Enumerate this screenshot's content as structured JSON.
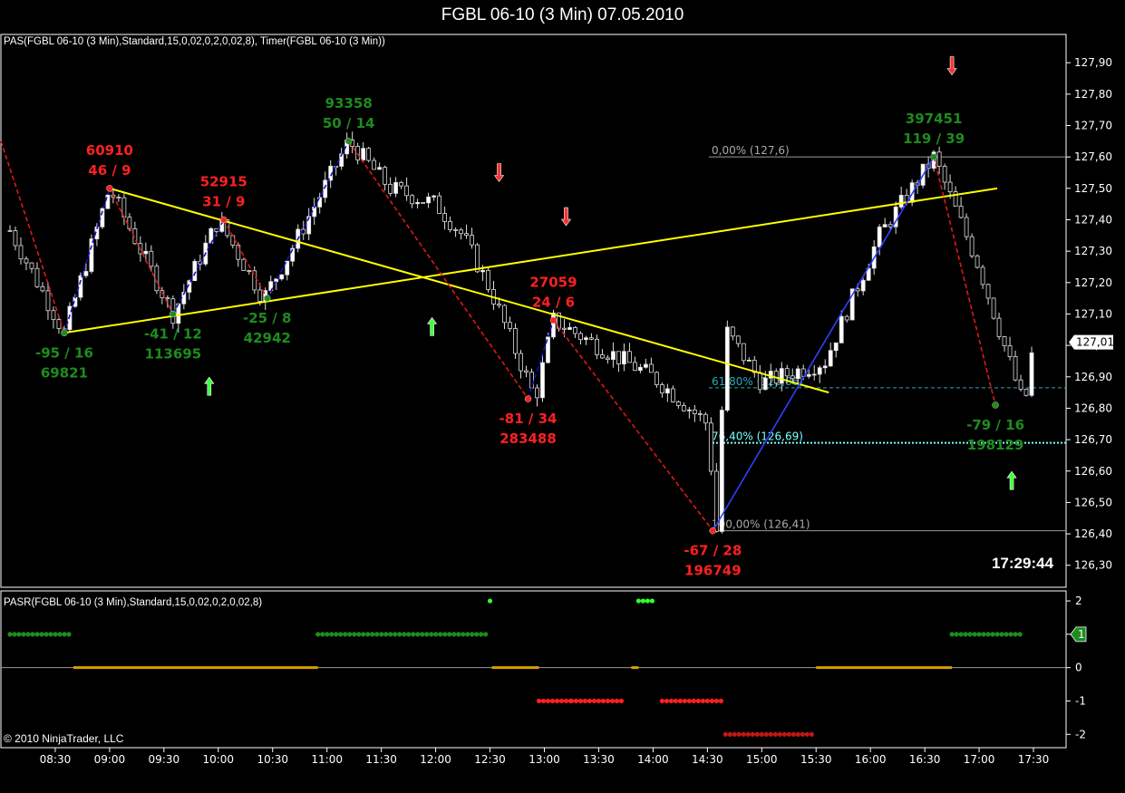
{
  "window_title": "FGBL 06-10 (3 Min)  07.05.2010",
  "indicator_label_main": "PAS(FGBL 06-10 (3 Min),Standard,15,0,02,0,2,0,02,8),  Timer(FGBL 06-10 (3 Min))",
  "indicator_label_sub": "PASR(FGBL 06-10 (3 Min),Standard,15,0,02,0,2,0,02,8)",
  "clock": "17:29:44",
  "copyright": "© 2010 NinjaTrader, LLC",
  "current_price_label": "127,01",
  "colors": {
    "up_candle": "#ffffff",
    "down_candle": "#000000",
    "bull": "#1e8c1e",
    "bear": "#ff2020",
    "trend": "#ffff00",
    "fib": "#00c8ff",
    "upwave": "#0000ff"
  },
  "chart_data": [
    {
      "type": "candlestick",
      "title": "FGBL 06-10 (3 Min)  07.05.2010",
      "y_axis_ticks": [
        "127,90",
        "127,80",
        "127,70",
        "127,60",
        "127,50",
        "127,40",
        "127,30",
        "127,20",
        "127,10",
        "127,00",
        "126,90",
        "126,80",
        "126,70",
        "126,60",
        "126,50",
        "126,40",
        "126,30"
      ],
      "x_axis_ticks": [
        "08:30",
        "09:00",
        "09:30",
        "10:00",
        "10:30",
        "11:00",
        "11:30",
        "12:00",
        "12:30",
        "13:00",
        "13:30",
        "14:00",
        "14:30",
        "15:00",
        "15:30",
        "16:00",
        "16:30",
        "17:00",
        "17:30"
      ],
      "ylim": [
        126.23,
        127.99
      ],
      "current_price": 127.01,
      "price_path": [
        [
          "08:00",
          127.42
        ],
        [
          "08:35",
          127.04
        ],
        [
          "09:00",
          127.5
        ],
        [
          "09:35",
          127.1
        ],
        [
          "10:00",
          127.4
        ],
        [
          "10:25",
          127.15
        ],
        [
          "10:38",
          127.28
        ],
        [
          "11:12",
          127.65
        ],
        [
          "11:35",
          127.5
        ],
        [
          "12:00",
          127.45
        ],
        [
          "12:15",
          127.35
        ],
        [
          "12:30",
          127.18
        ],
        [
          "12:55",
          126.83
        ],
        [
          "13:05",
          127.08
        ],
        [
          "13:35",
          126.98
        ],
        [
          "14:00",
          126.9
        ],
        [
          "14:30",
          126.75
        ],
        [
          "14:35",
          126.41
        ],
        [
          "14:40",
          127.05
        ],
        [
          "15:00",
          126.88
        ],
        [
          "15:35",
          126.95
        ],
        [
          "16:05",
          127.35
        ],
        [
          "16:35",
          127.6
        ],
        [
          "17:00",
          127.25
        ],
        [
          "17:25",
          126.8
        ],
        [
          "17:30",
          127.01
        ]
      ],
      "swings": [
        {
          "time": "08:35",
          "price": 127.04,
          "kind": "low",
          "ratio": "-95 / 16",
          "volume": "69821"
        },
        {
          "time": "09:00",
          "price": 127.5,
          "kind": "high",
          "ratio": "46 / 9",
          "volume": "60910"
        },
        {
          "time": "09:35",
          "price": 127.1,
          "kind": "low",
          "ratio": "-41 / 12",
          "volume": "113695"
        },
        {
          "time": "10:03",
          "price": 127.4,
          "kind": "high",
          "ratio": "31 / 9",
          "volume": "52915"
        },
        {
          "time": "10:27",
          "price": 127.15,
          "kind": "low",
          "ratio": "-25 / 8",
          "volume": "42942"
        },
        {
          "time": "11:12",
          "price": 127.65,
          "kind": "high",
          "ratio": "50 / 14",
          "volume": "93358"
        },
        {
          "time": "12:51",
          "price": 126.83,
          "kind": "low",
          "ratio": "-81 / 34",
          "volume": "283488"
        },
        {
          "time": "13:05",
          "price": 127.08,
          "kind": "high",
          "ratio": "24 / 6",
          "volume": "27059"
        },
        {
          "time": "14:33",
          "price": 126.41,
          "kind": "low",
          "ratio": "-67 / 28",
          "volume": "196749"
        },
        {
          "time": "16:35",
          "price": 127.6,
          "kind": "high",
          "ratio": "119 / 39",
          "volume": "397451"
        },
        {
          "time": "17:09",
          "price": 126.81,
          "kind": "low",
          "ratio": "-79 / 16",
          "volume": "198129"
        }
      ],
      "fib_levels": [
        {
          "label": "0,00% (127,6)",
          "price": 127.6
        },
        {
          "label": "61,80% (126,86)",
          "price": 126.865
        },
        {
          "label": "76,40% (126,69)",
          "price": 126.69
        },
        {
          "label": "100,00% (126,41)",
          "price": 126.41
        }
      ],
      "arrows": [
        {
          "time": "09:55",
          "price": 126.87,
          "dir": "up"
        },
        {
          "time": "11:58",
          "price": 127.06,
          "dir": "up"
        },
        {
          "time": "12:35",
          "price": 127.55,
          "dir": "down"
        },
        {
          "time": "13:12",
          "price": 127.41,
          "dir": "down"
        },
        {
          "time": "16:45",
          "price": 127.89,
          "dir": "down"
        },
        {
          "time": "17:18",
          "price": 126.57,
          "dir": "up"
        }
      ],
      "trend_lines": [
        {
          "from": [
            "08:35",
            127.04
          ],
          "to": [
            "17:10",
            127.5
          ]
        },
        {
          "from": [
            "09:00",
            127.5
          ],
          "to": [
            "15:37",
            126.85
          ]
        }
      ]
    },
    {
      "type": "scatter",
      "title": "PASR(FGBL 06-10 (3 Min),Standard,15,0,02,0,2,0,02,8)",
      "y_axis_ticks": [
        "2",
        "1",
        "0",
        "-1",
        "-2"
      ],
      "ylim": [
        -2.4,
        2.3
      ],
      "current_value": "1",
      "segments": [
        {
          "from": "08:05",
          "to": "08:40",
          "value": 1
        },
        {
          "from": "08:40",
          "to": "10:55",
          "value": 0
        },
        {
          "from": "10:55",
          "to": "12:30",
          "value": 1
        },
        {
          "from": "12:30",
          "to": "12:31",
          "value": 2
        },
        {
          "from": "12:31",
          "to": "12:57",
          "value": 0
        },
        {
          "from": "12:57",
          "to": "13:15",
          "value": -1
        },
        {
          "from": "13:15",
          "to": "13:45",
          "value": -1
        },
        {
          "from": "13:48",
          "to": "13:52",
          "value": 0
        },
        {
          "from": "13:52",
          "to": "14:00",
          "value": 2
        },
        {
          "from": "14:05",
          "to": "14:40",
          "value": -1
        },
        {
          "from": "14:40",
          "to": "15:30",
          "value": -2
        },
        {
          "from": "15:30",
          "to": "16:45",
          "value": 0
        },
        {
          "from": "16:45",
          "to": "17:25",
          "value": 1
        }
      ]
    }
  ]
}
